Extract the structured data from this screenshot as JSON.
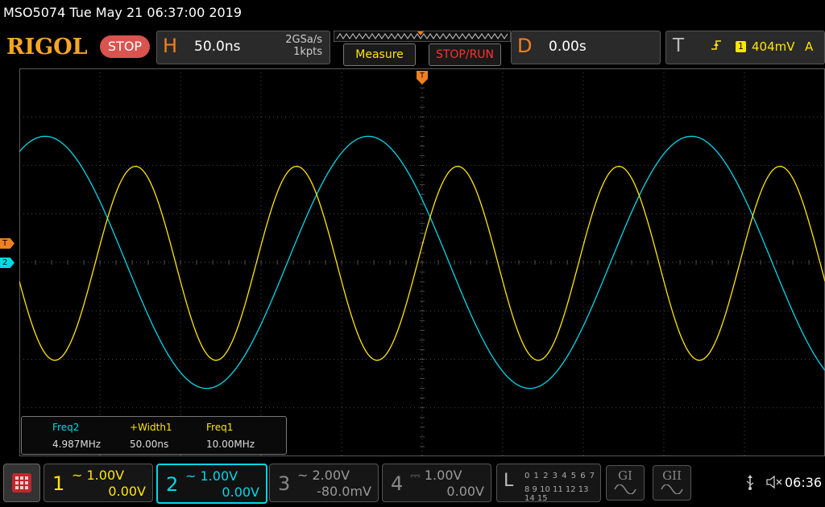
{
  "title_bar": {
    "text": "MSO5074  Tue May 21 06:37:00 2019"
  },
  "brand": "RIGOL",
  "run_state": "STOP",
  "horizontal": {
    "letter": "H",
    "timebase": "50.0ns",
    "sample_rate": "2GSa/s",
    "memory_depth": "1kpts"
  },
  "buttons": {
    "measure": "Measure",
    "stop_run": "STOP/RUN"
  },
  "delay": {
    "letter": "D",
    "value": "0.00s"
  },
  "trigger": {
    "letter": "T",
    "edge_icon": "rising-edge-icon",
    "source": "1",
    "level": "404mV",
    "mode": "A"
  },
  "markers": {
    "trigger": "T",
    "channel2": "2"
  },
  "measurements": [
    {
      "label": "Freq2",
      "value": "4.987MHz",
      "color": "#00d8e8"
    },
    {
      "label": "+Width1",
      "value": "50.00ns",
      "color": "#ffe600"
    },
    {
      "label": "Freq1",
      "value": "10.00MHz",
      "color": "#ffe600"
    }
  ],
  "channels": [
    {
      "num": "1",
      "coupling_icon": "~",
      "scale": "1.00V",
      "offset": "0.00V",
      "color": "#ffe600"
    },
    {
      "num": "2",
      "coupling_icon": "~",
      "scale": "1.00V",
      "offset": "0.00V",
      "color": "#00d8e8"
    },
    {
      "num": "3",
      "coupling_icon": "~",
      "scale": "2.00V",
      "offset": "-80.0mV",
      "color": "#888888"
    },
    {
      "num": "4",
      "coupling_icon": "⎓",
      "scale": "1.00V",
      "offset": "0.00V",
      "color": "#888888"
    }
  ],
  "logic": {
    "letter": "L",
    "row1": "0 1 2 3  4 5 6 7",
    "row2": "8 9 10 11 12 13 14 15"
  },
  "generators": [
    {
      "label": "GI"
    },
    {
      "label": "GII"
    }
  ],
  "status": {
    "clock": "06:36"
  },
  "colors": {
    "ch1": "#ffe600",
    "ch2": "#00d8e8",
    "accent": "#f08020"
  },
  "waveforms": {
    "ch1": {
      "frequency_hz": 10000000,
      "amplitude_div": 2.0,
      "phase_note": "rising edge at trigger"
    },
    "ch2": {
      "frequency_hz": 4987000,
      "amplitude_div": 2.6
    }
  }
}
